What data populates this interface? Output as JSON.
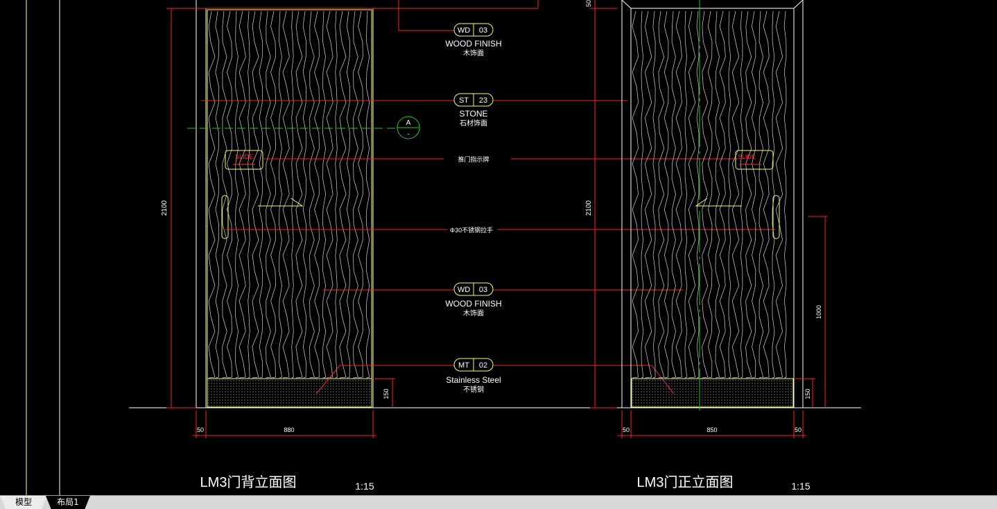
{
  "drawing": {
    "left_view": {
      "title": "LM3门背立面图",
      "scale": "1:15",
      "height_dim": "2100",
      "width_dim": "880",
      "side_dim": "50",
      "base_dim": "150"
    },
    "right_view": {
      "title": "LM3门正立面图",
      "scale": "1:15",
      "height_dim": "2100",
      "top_dim": "50",
      "width_dim": "850",
      "side_dim_left": "50",
      "side_dim_right": "50",
      "base_dim": "150",
      "handle_height_dim": "1000"
    },
    "tags": [
      {
        "code": "WD",
        "num": "03",
        "en": "WOOD FINISH",
        "cn": "木饰面"
      },
      {
        "code": "ST",
        "num": "23",
        "en": "STONE",
        "cn": "石材饰面"
      },
      {
        "code": "WD",
        "num": "03",
        "en": "WOOD FINISH",
        "cn": "木饰面"
      },
      {
        "code": "MT",
        "num": "02",
        "en": "Stainless Steel",
        "cn": "不锈钢"
      }
    ],
    "notes": {
      "slide_sign": "推门指示牌",
      "handle": "Φ30不锈钢拉手"
    },
    "slide_label": "SLIDE",
    "section_marker": {
      "letter": "A",
      "sub": "-"
    }
  },
  "tabs": {
    "model": "模型",
    "layout": "布局1"
  },
  "colors": {
    "background": "#000000",
    "red": "#ff2020",
    "yellow": "#ffff66",
    "green": "#22cc22",
    "white": "#ffffff"
  }
}
